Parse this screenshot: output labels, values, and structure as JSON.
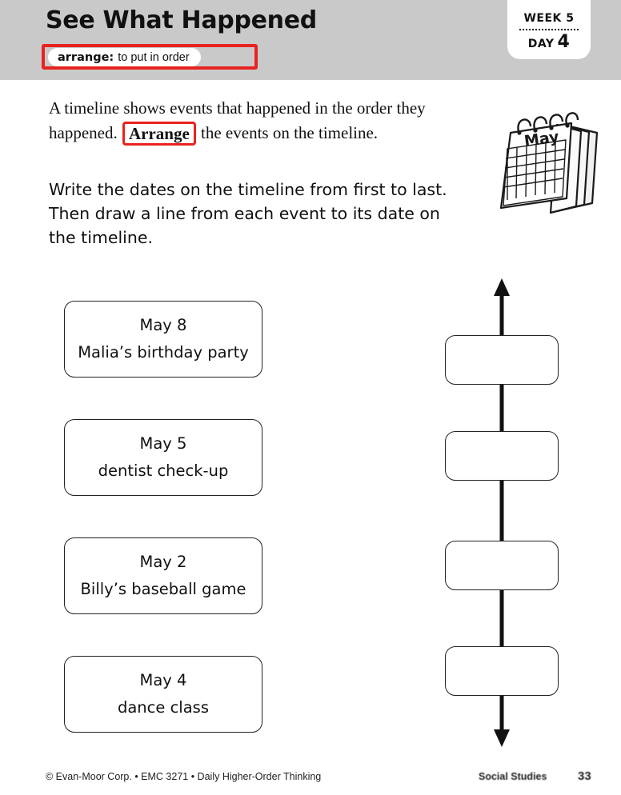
{
  "header": {
    "title": "See What Happened",
    "vocab": {
      "term": "arrange:",
      "definition": "to put in order"
    },
    "badge": {
      "week_label": "WEEK 5",
      "day_label": "DAY",
      "day_number": "4"
    },
    "band_color": "#c9c9c9",
    "highlight_color": "#e8231f"
  },
  "intro": {
    "before": "A timeline shows events that happened in the order they happened.",
    "highlight_word": "Arrange",
    "after": "the events on the timeline."
  },
  "directions": {
    "text": "Write the dates on the timeline from first to last. Then draw a line from each event to its date on the timeline."
  },
  "illustration": {
    "name": "calendar-illustration",
    "month_label": "May"
  },
  "events": [
    {
      "date": "May 8",
      "name": "Malia’s birthday party"
    },
    {
      "date": "May 5",
      "name": "dentist check-up"
    },
    {
      "date": "May 2",
      "name": "Billy’s baseball game"
    },
    {
      "date": "May 4",
      "name": "dance class"
    }
  ],
  "timeline": {
    "name": "vertical-timeline",
    "slot_count": 4,
    "slots": [
      "",
      "",
      "",
      ""
    ],
    "top_arrow": "arrow-up",
    "bottom_arrow": "arrow-down"
  },
  "footer": {
    "credit": "© Evan-Moor Corp. • EMC 3271 • Daily Higher-Order Thinking",
    "subject": "Social Studies",
    "page_number": "33"
  }
}
